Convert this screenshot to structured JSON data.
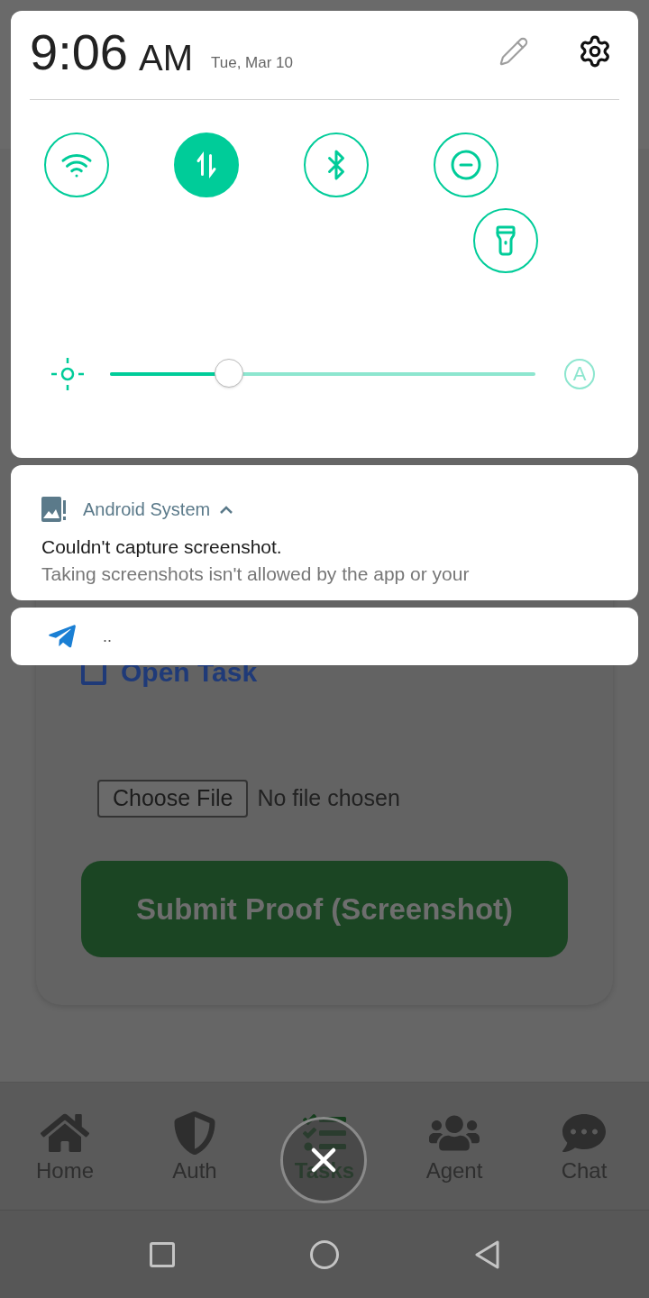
{
  "quick_settings": {
    "time": "9:06",
    "meridiem": "AM",
    "date": "Tue, Mar 10",
    "tiles": [
      {
        "kind": "wifi",
        "on": false
      },
      {
        "kind": "data",
        "on": true
      },
      {
        "kind": "bluetooth",
        "on": false
      },
      {
        "kind": "dnd",
        "on": false
      },
      {
        "kind": "flashlight",
        "on": false
      }
    ],
    "brightness": {
      "level": 0.28,
      "auto_label": "A"
    }
  },
  "notifications": [
    {
      "kind": "system",
      "app": "Android System",
      "expanded": true,
      "title": "Couldn't capture screenshot.",
      "text": "Taking screenshots isn't allowed by the app or your"
    },
    {
      "kind": "telegram",
      "text": ".."
    }
  ],
  "task_card": {
    "checked": false,
    "open_task": "Open Task",
    "file_button": "Choose File",
    "file_status": "No file chosen",
    "submit": "Submit Proof (Screenshot)"
  },
  "bottom_nav": [
    {
      "kind": "home",
      "label": "Home",
      "selected": false
    },
    {
      "kind": "shield",
      "label": "Auth",
      "selected": false
    },
    {
      "kind": "tasks",
      "label": "Tasks",
      "selected": true
    },
    {
      "kind": "users",
      "label": "Agent",
      "selected": false
    },
    {
      "kind": "chat",
      "label": "Chat",
      "selected": false
    }
  ]
}
